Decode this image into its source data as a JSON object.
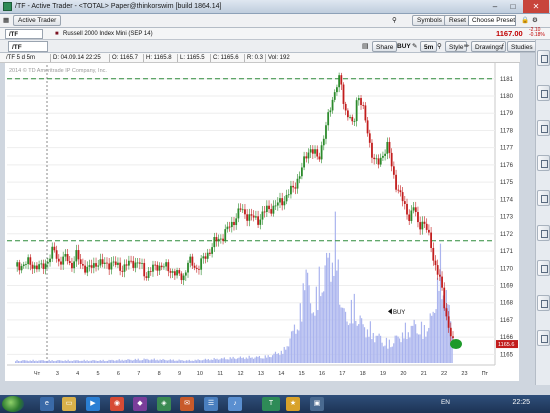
{
  "window": {
    "title": "/TF - Active Trader - <TOTAL> Paper@thinkorswim [build 1864.14]"
  },
  "toolbar1": {
    "active_trader_label": "Active Trader",
    "symbols_label": "Symbols",
    "reset_label": "Reset",
    "preset_placeholder": "Choose Preset"
  },
  "quote": {
    "symbol": "/TF",
    "description": "Russell 2000 Index Mini (SEP 14)",
    "last_price": "1167.00",
    "change": "-2.10",
    "change_pct": "-0.18%"
  },
  "chart_toolbar": {
    "symbol": "/TF",
    "share_label": "Share",
    "buy_label": "BUY",
    "timeframe": "5m",
    "style_label": "Style",
    "drawings_label": "Drawings",
    "studies_label": "Studies"
  },
  "infobar": {
    "chart_label": "/TF 5 d 5m",
    "date": "D: 04.09.14 22:25",
    "open": "O: 1165.7",
    "high": "H: 1165.8",
    "low": "L: 1165.5",
    "close": "C: 1165.6",
    "range": "R: 0.3",
    "volume": "Vol: 192"
  },
  "chart_data": {
    "type": "candlestick",
    "title": "",
    "watermark": "2014 © TD Ameritrade IP Company, Inc.",
    "y_axis": {
      "ylim": [
        1164.5,
        1181.8
      ],
      "ticks": [
        1165,
        1166,
        1167,
        1168,
        1169,
        1170,
        1171,
        1172,
        1173,
        1174,
        1175,
        1176,
        1177,
        1178,
        1179,
        1180,
        1181
      ]
    },
    "x_axis": {
      "tick_labels": [
        "Чт",
        "3",
        "4",
        "5",
        "6",
        "7",
        "8",
        "9",
        "10",
        "11",
        "12",
        "13",
        "14",
        "15",
        "16",
        "17",
        "18",
        "19",
        "20",
        "21",
        "22",
        "23",
        "Пт"
      ]
    },
    "horizontal_lines": [
      1181.0,
      1171.6
    ],
    "annotations": [
      {
        "text": "BUY",
        "price": 1167.5
      }
    ],
    "current_price_label": "1165.6",
    "price_path": [
      [
        0,
        1170.1
      ],
      [
        3,
        1170.3
      ],
      [
        6,
        1170.0
      ],
      [
        8,
        1170.6
      ],
      [
        9,
        1171.1
      ],
      [
        10,
        1170.4
      ],
      [
        12,
        1170.6
      ],
      [
        13,
        1170.1
      ],
      [
        14,
        1170.8
      ],
      [
        15,
        1170.3
      ],
      [
        17,
        1169.9
      ],
      [
        19,
        1170.4
      ],
      [
        20,
        1170.2
      ],
      [
        22,
        1170.3
      ],
      [
        25,
        1170.0
      ],
      [
        27,
        1170.4
      ],
      [
        29,
        1170.2
      ],
      [
        30,
        1169.6
      ],
      [
        33,
        1170.2
      ],
      [
        36,
        1169.9
      ],
      [
        38,
        1169.5
      ],
      [
        39,
        1169.6
      ],
      [
        40,
        1170.4
      ],
      [
        42,
        1170.0
      ],
      [
        44,
        1170.7
      ],
      [
        46,
        1171.5
      ],
      [
        48,
        1171.9
      ],
      [
        50,
        1172.6
      ],
      [
        52,
        1173.4
      ],
      [
        54,
        1173.0
      ],
      [
        56,
        1172.8
      ],
      [
        58,
        1173.4
      ],
      [
        60,
        1173.6
      ],
      [
        62,
        1174.0
      ],
      [
        64,
        1174.6
      ],
      [
        66,
        1175.6
      ],
      [
        67,
        1176.5
      ],
      [
        68,
        1177.0
      ],
      [
        70,
        1176.3
      ],
      [
        71,
        1177.5
      ],
      [
        72,
        1178.5
      ],
      [
        73,
        1179.6
      ],
      [
        74,
        1180.6
      ],
      [
        75,
        1181.0
      ],
      [
        76,
        1179.2
      ],
      [
        77,
        1179.0
      ],
      [
        78,
        1178.0
      ],
      [
        79,
        1180.2
      ],
      [
        80,
        1179.6
      ],
      [
        81,
        1178.2
      ],
      [
        82,
        1177.0
      ],
      [
        83,
        1176.2
      ],
      [
        84,
        1176.0
      ],
      [
        85,
        1176.8
      ],
      [
        86,
        1177.2
      ],
      [
        87,
        1175.6
      ],
      [
        88,
        1174.8
      ],
      [
        89,
        1174.2
      ],
      [
        90,
        1173.4
      ],
      [
        91,
        1173.0
      ],
      [
        92,
        1173.6
      ],
      [
        93,
        1172.4
      ],
      [
        94,
        1172.8
      ],
      [
        95,
        1172.2
      ],
      [
        96,
        1171.2
      ],
      [
        97,
        1170.1
      ],
      [
        98,
        1169.3
      ],
      [
        99,
        1167.9
      ],
      [
        100,
        1166.6
      ],
      [
        101,
        1165.6
      ]
    ],
    "volume_profile": [
      [
        0,
        0.02
      ],
      [
        10,
        0.02
      ],
      [
        20,
        0.02
      ],
      [
        30,
        0.03
      ],
      [
        40,
        0.02
      ],
      [
        50,
        0.04
      ],
      [
        58,
        0.05
      ],
      [
        62,
        0.1
      ],
      [
        64,
        0.25
      ],
      [
        66,
        0.4
      ],
      [
        67,
        0.9
      ],
      [
        68,
        0.4
      ],
      [
        70,
        0.6
      ],
      [
        72,
        0.8
      ],
      [
        74,
        0.95
      ],
      [
        75,
        0.5
      ],
      [
        76,
        0.35
      ],
      [
        78,
        0.45
      ],
      [
        80,
        0.3
      ],
      [
        82,
        0.25
      ],
      [
        84,
        0.2
      ],
      [
        86,
        0.15
      ],
      [
        88,
        0.2
      ],
      [
        90,
        0.25
      ],
      [
        92,
        0.3
      ],
      [
        94,
        0.25
      ],
      [
        96,
        0.35
      ],
      [
        98,
        0.75
      ],
      [
        100,
        0.4
      ],
      [
        101,
        0.2
      ]
    ]
  },
  "taskbar": {
    "lang": "EN",
    "time": "22:25"
  }
}
